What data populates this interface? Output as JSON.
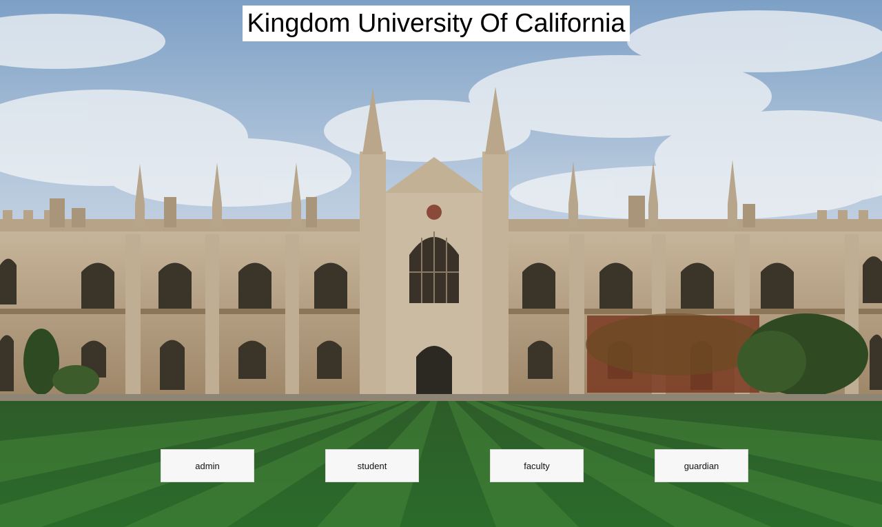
{
  "window": {
    "title": "Kingdom University Of California"
  },
  "background": {
    "image_name": "university-gothic-building-photo",
    "sky_color": "#8fb0d4",
    "stone_color": "#b9a48a",
    "lawn_color": "#2f6a2a"
  },
  "buttons": [
    {
      "id": "admin",
      "label": "admin"
    },
    {
      "id": "student",
      "label": "student"
    },
    {
      "id": "faculty",
      "label": "faculty"
    },
    {
      "id": "guardian",
      "label": "guardian"
    }
  ]
}
